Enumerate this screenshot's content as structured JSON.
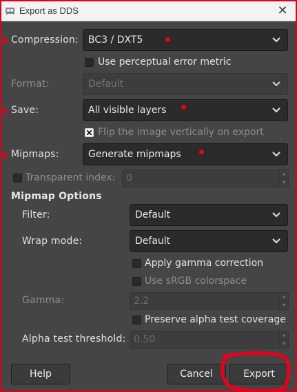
{
  "window": {
    "title": "Export as DDS",
    "app_icon": "gimp-icon",
    "close_icon": "close-icon"
  },
  "fields": {
    "compression": {
      "label": "Compression:",
      "value": "BC3 / DXT5"
    },
    "perceptual": {
      "label": "Use perceptual error metric",
      "checked": false
    },
    "format": {
      "label": "Format:",
      "value": "Default",
      "enabled": false
    },
    "save": {
      "label": "Save:",
      "value": "All visible layers"
    },
    "flip": {
      "label": "Flip the image vertically on export",
      "checked": true,
      "enabled": false
    },
    "mipmaps": {
      "label": "Mipmaps:",
      "value": "Generate mipmaps"
    },
    "transparent_index": {
      "label": "Transparent index:",
      "value": "0",
      "checked": false,
      "enabled": false
    }
  },
  "mipmap_options": {
    "heading": "Mipmap Options",
    "filter": {
      "label": "Filter:",
      "value": "Default"
    },
    "wrap_mode": {
      "label": "Wrap mode:",
      "value": "Default"
    },
    "gamma_correction": {
      "label": "Apply gamma correction",
      "checked": false
    },
    "srgb": {
      "label": "Use sRGB colorspace",
      "checked": false,
      "enabled": false
    },
    "gamma": {
      "label": "Gamma:",
      "value": "2.2",
      "enabled": false
    },
    "alpha_coverage": {
      "label": "Preserve alpha test coverage",
      "checked": false
    },
    "alpha_threshold": {
      "label": "Alpha test threshold:",
      "value": "0.50",
      "enabled": false
    }
  },
  "buttons": {
    "help": "Help",
    "cancel": "Cancel",
    "export": "Export"
  },
  "colors": {
    "annotation": "#e8001c",
    "dialog_bg": "#454545",
    "field_bg": "#2b2b2b"
  }
}
